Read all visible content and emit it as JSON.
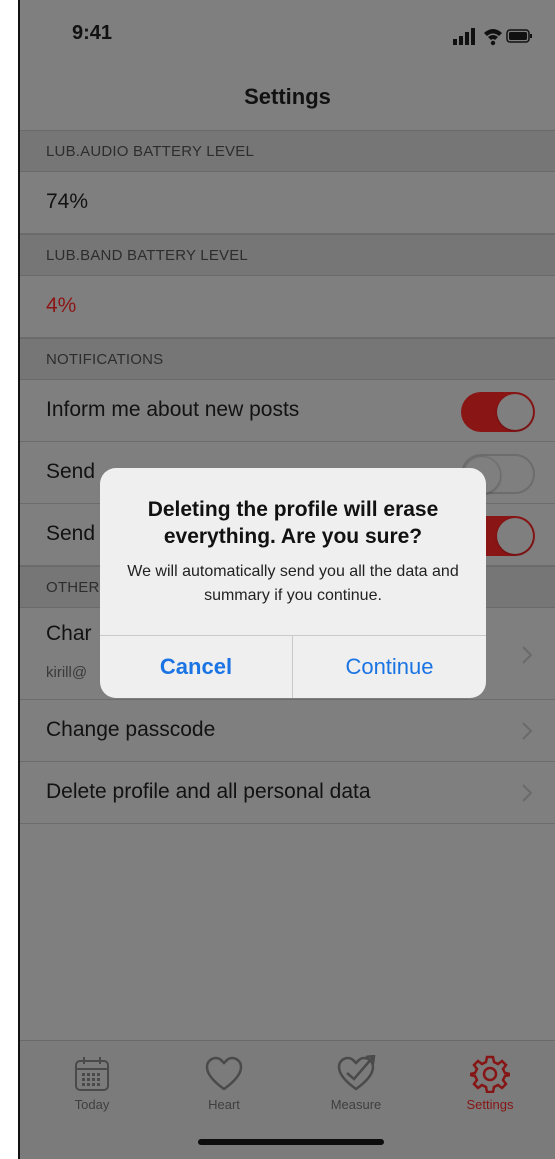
{
  "status_bar": {
    "time": "9:41"
  },
  "nav": {
    "title": "Settings"
  },
  "sections": {
    "audio_header": "LUB.AUDIO BATTERY LEVEL",
    "audio_value": "74%",
    "band_header": "LUB.BAND BATTERY LEVEL",
    "band_value": "4%",
    "notifications_header": "NOTIFICATIONS",
    "other_header": "OTHER"
  },
  "notifications": [
    {
      "label": "Inform me about new posts",
      "on": true
    },
    {
      "label": "Send",
      "on": false
    },
    {
      "label": "Send",
      "on": true
    }
  ],
  "other": {
    "change_email_label": "Char",
    "change_email_sub": "kirill@",
    "change_passcode_label": "Change passcode",
    "delete_label": "Delete profile and all personal data"
  },
  "alert": {
    "title": "Deleting the profile will erase everything. Are you sure?",
    "message": "We will automatically send you all the data and summary if you continue.",
    "cancel": "Cancel",
    "continue": "Continue"
  },
  "tabs": [
    {
      "label": "Today",
      "icon": "calendar-icon",
      "active": false
    },
    {
      "label": "Heart",
      "icon": "heart-icon",
      "active": false
    },
    {
      "label": "Measure",
      "icon": "heart-check-icon",
      "active": false
    },
    {
      "label": "Settings",
      "icon": "gear-icon",
      "active": true
    }
  ],
  "colors": {
    "accent_red": "#d0021b",
    "link_blue": "#1b74e4"
  }
}
